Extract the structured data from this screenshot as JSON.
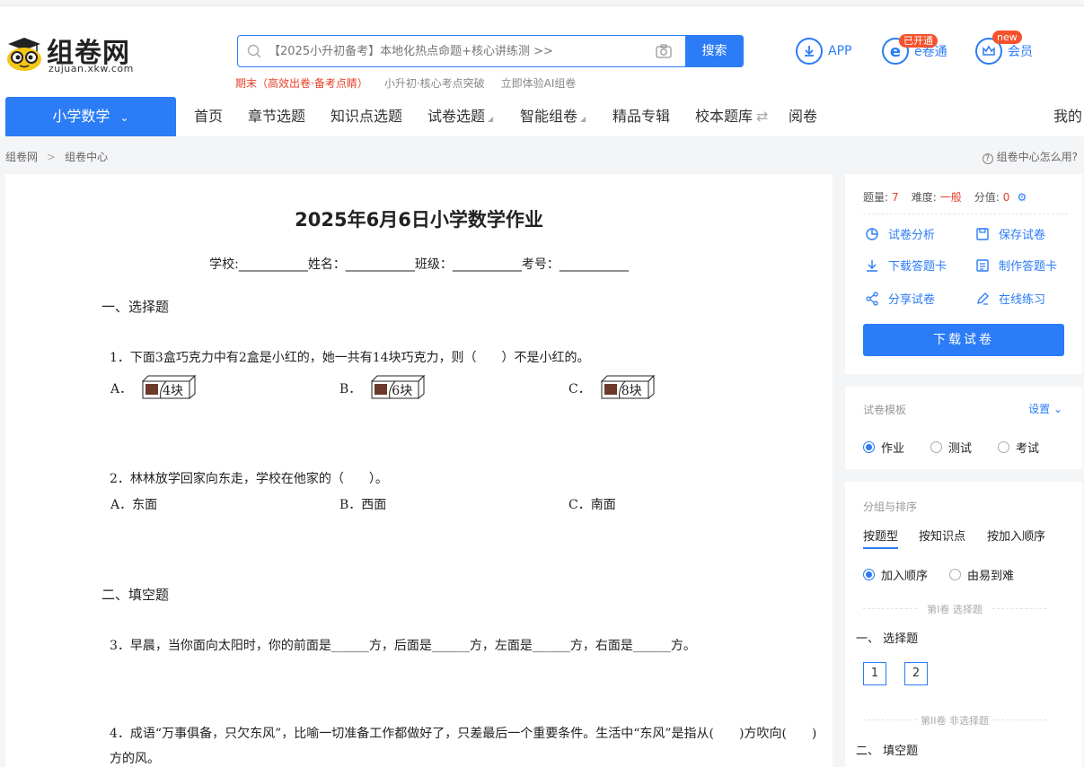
{
  "header": {
    "logo_text": "组卷网",
    "logo_sub": "zujuan.xkw.com",
    "search_placeholder": "【2025小升初备考】本地化热点命题+核心讲练测 >>",
    "search_button": "搜索",
    "hot_links": [
      "期末（高效出卷·备考点睛）",
      "小升初·核心考点突破",
      "立即体验AI组卷"
    ],
    "app_label": "APP",
    "etong_label": "e卷通",
    "etong_badge": "已开通",
    "vip_label": "会员",
    "vip_badge": "new"
  },
  "nav": {
    "subject": "小学数学",
    "items": [
      "首页",
      "章节选题",
      "知识点选题",
      "试卷选题",
      "智能组卷",
      "精品专辑",
      "校本题库",
      "阅卷"
    ],
    "mine": "我的"
  },
  "breadcrumb": {
    "home": "组卷网",
    "sep": ">",
    "current": "组卷中心",
    "help": "组卷中心怎么用?"
  },
  "paper": {
    "title": "2025年6月6日小学数学作业",
    "info": "学校:___________姓名：___________班级：___________考号：___________",
    "section1": "一、选择题",
    "q1": "1．下面3盒巧克力中有2盒是小红的，她一共有14块巧克力，则（　　）不是小红的。",
    "q1_options": [
      {
        "letter": "A．",
        "text": "4块"
      },
      {
        "letter": "B．",
        "text": "6块"
      },
      {
        "letter": "C．",
        "text": "8块"
      }
    ],
    "q2": "2．林林放学回家向东走，学校在他家的（　　）。",
    "q2_options": [
      "A．东面",
      "B．西面",
      "C．南面"
    ],
    "section2": "二、填空题",
    "q3": "3．早晨，当你面向太阳时，你的前面是______方，后面是______方，左面是______方，右面是______方。",
    "q4_line1": "4．成语“万事俱备，只欠东风”，比喻一切准备工作都做好了，只差最后一个重要条件。生活中“东风”是指从(　　)方吹向(　　)",
    "q4_line2": "方的风。"
  },
  "side": {
    "count_label": "题量:",
    "count": "7",
    "difficulty_label": "难度:",
    "difficulty": "一般",
    "score_label": "分值:",
    "score": "0",
    "actions": [
      "试卷分析",
      "保存试卷",
      "下载答题卡",
      "制作答题卡",
      "分享试卷",
      "在线练习"
    ],
    "download": "下载试卷",
    "template_title": "试卷模板",
    "template_setting": "设置",
    "templates": [
      "作业",
      "测试",
      "考试"
    ],
    "group_title": "分组与排序",
    "group_tabs": [
      "按题型",
      "按知识点",
      "按加入顺序"
    ],
    "order_options": [
      "加入顺序",
      "由易到难"
    ],
    "vol1_label": "第I卷 选择题",
    "vol1_section": "一、 选择题",
    "vol1_nums": [
      "1",
      "2"
    ],
    "vol2_label": "第II卷 非选择题",
    "vol2_section": "二、 填空题"
  },
  "colors": {
    "accent": "#2b7cf6",
    "red": "#e8402a"
  }
}
